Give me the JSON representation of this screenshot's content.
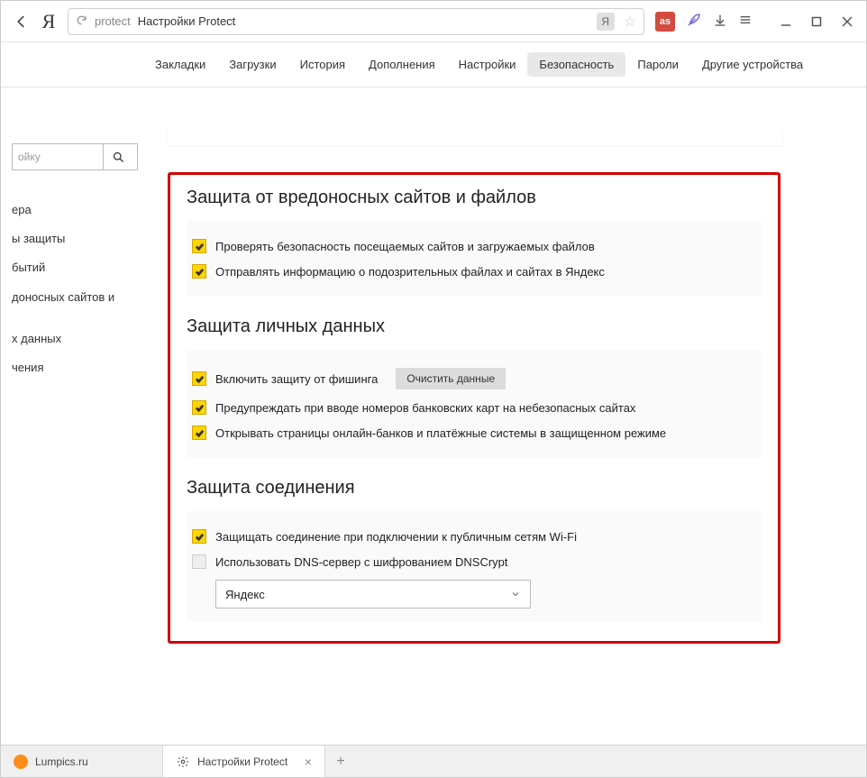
{
  "topbar": {
    "logo": "Я",
    "address_prefix": "protect",
    "address_title": "Настройки Protect",
    "ybadge": "Я",
    "ext_label": "as"
  },
  "nav": {
    "tabs": [
      {
        "label": "Закладки"
      },
      {
        "label": "Загрузки"
      },
      {
        "label": "История"
      },
      {
        "label": "Дополнения"
      },
      {
        "label": "Настройки"
      },
      {
        "label": "Безопасность",
        "active": true
      },
      {
        "label": "Пароли"
      },
      {
        "label": "Другие устройства"
      }
    ]
  },
  "search": {
    "placeholder": "ойку"
  },
  "sidebar": {
    "items": [
      {
        "label": "ера"
      },
      {
        "label": "ы защиты"
      },
      {
        "label": "бытий"
      },
      {
        "label": "доносных сайтов и"
      },
      {
        "label": "х данных"
      },
      {
        "label": "чения"
      }
    ]
  },
  "sections": {
    "s1": {
      "title": "Защита от вредоносных сайтов и файлов",
      "opt1": "Проверять безопасность посещаемых сайтов и загружаемых файлов",
      "opt2": "Отправлять информацию о подозрительных файлах и сайтах в Яндекс"
    },
    "s2": {
      "title": "Защита личных данных",
      "opt1": "Включить защиту от фишинга",
      "clear_btn": "Очистить данные",
      "opt2": "Предупреждать при вводе номеров банковских карт на небезопасных сайтах",
      "opt3": "Открывать страницы онлайн-банков и платёжные системы в защищенном режиме"
    },
    "s3": {
      "title": "Защита соединения",
      "opt1": "Защищать соединение при подключении к публичным сетям Wi-Fi",
      "opt2": "Использовать DNS-сервер с шифрованием DNSCrypt",
      "select_value": "Яндекс"
    }
  },
  "bottom": {
    "tab1": "Lumpics.ru",
    "tab2": "Настройки Protect"
  }
}
